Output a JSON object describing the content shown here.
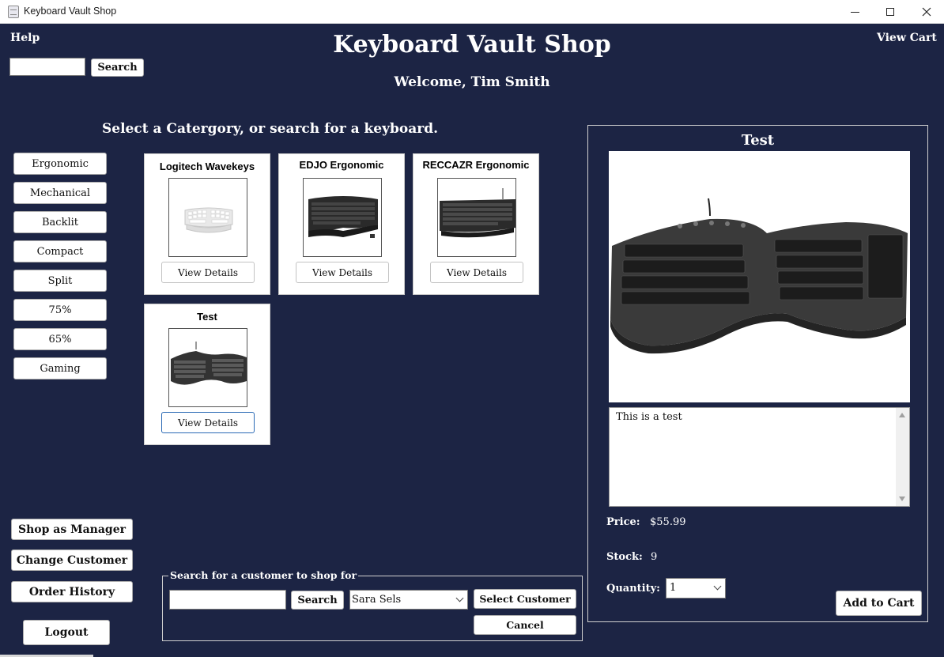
{
  "window": {
    "title": "Keyboard Vault Shop"
  },
  "header": {
    "help_label": "Help",
    "view_cart_label": "View Cart",
    "app_title": "Keyboard Vault Shop",
    "welcome": "Welcome, Tim Smith",
    "search_button": "Search",
    "search_value": ""
  },
  "prompt": "Select a Catergory, or search for a keyboard.",
  "categories": [
    "Ergonomic",
    "Mechanical",
    "Backlit",
    "Compact",
    "Split",
    "75%",
    "65%",
    "Gaming"
  ],
  "products": [
    {
      "name": "Logitech Wavekeys",
      "button": "View Details",
      "image": "white-keyboard-image"
    },
    {
      "name": "EDJO Ergonomic",
      "button": "View Details",
      "image": "black-ergonomic-keyboard-image"
    },
    {
      "name": "RECCAZR Ergonomic",
      "button": "View Details",
      "image": "black-keyboard-image"
    },
    {
      "name": "Test",
      "button": "View Details",
      "image": "split-ergonomic-keyboard-image"
    }
  ],
  "detail": {
    "title": "Test",
    "description": "This is a test",
    "price_label": "Price:",
    "price": "$55.99",
    "stock_label": "Stock:",
    "stock": "9",
    "quantity_label": "Quantity:",
    "quantity": "1",
    "add_to_cart": "Add to Cart"
  },
  "sidebar_actions": {
    "shop_as_manager": "Shop as Manager",
    "change_customer": "Change Customer",
    "order_history": "Order History",
    "logout": "Logout"
  },
  "customer_search": {
    "legend": "Search for a customer to shop for",
    "search_value": "",
    "search_button": "Search",
    "selected_customer": "Sara Sels",
    "select_button": "Select Customer",
    "cancel_button": "Cancel"
  },
  "colors": {
    "background": "#1c2444",
    "text": "#ffffff",
    "button_bg": "#ffffff"
  }
}
